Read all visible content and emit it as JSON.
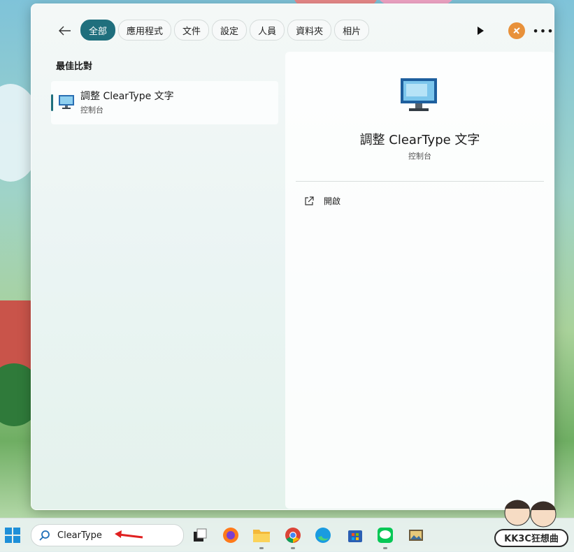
{
  "filters": {
    "tabs": [
      {
        "label": "全部",
        "active": true
      },
      {
        "label": "應用程式",
        "active": false
      },
      {
        "label": "文件",
        "active": false
      },
      {
        "label": "設定",
        "active": false
      },
      {
        "label": "人員",
        "active": false
      },
      {
        "label": "資料夾",
        "active": false
      },
      {
        "label": "相片",
        "active": false
      }
    ]
  },
  "results": {
    "section_title": "最佳比對",
    "best_match": {
      "title": "調整 ClearType 文字",
      "subtitle": "控制台",
      "icon": "monitor-icon"
    }
  },
  "detail": {
    "title": "調整 ClearType 文字",
    "subtitle": "控制台",
    "actions": [
      {
        "label": "開啟",
        "icon": "open-external-icon"
      }
    ]
  },
  "taskbar": {
    "search": {
      "value": "ClearType"
    },
    "apps": [
      "task-view-icon",
      "firefox-icon",
      "file-explorer-icon",
      "chrome-icon",
      "edge-icon",
      "microsoft-store-icon",
      "line-icon",
      "photos-icon"
    ]
  },
  "watermark": {
    "text": "KK3C狂想曲"
  },
  "colors": {
    "accent": "#1f6f7d",
    "annotation_arrow": "#e02020"
  }
}
